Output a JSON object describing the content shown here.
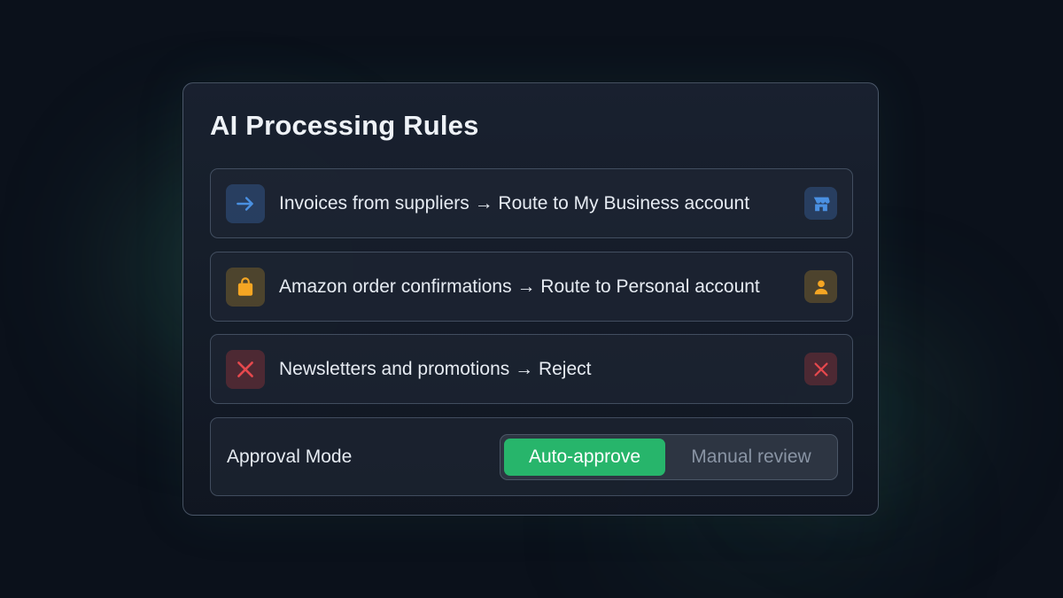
{
  "panel": {
    "title": "AI Processing Rules"
  },
  "rules": [
    {
      "text": "Invoices from suppliers → Route to My Business account",
      "lead_icon": "arrow-right-icon",
      "trail_icon": "store-icon",
      "accent": "#4a90e2"
    },
    {
      "text": "Amazon order confirmations → Route to Personal account",
      "lead_icon": "shopping-bag-icon",
      "trail_icon": "user-icon",
      "accent": "#f5a623"
    },
    {
      "text": "Newsletters and promotions → Reject",
      "lead_icon": "x-icon",
      "trail_icon": "x-icon",
      "accent": "#e5484d"
    }
  ],
  "approval": {
    "label": "Approval Mode",
    "options": [
      "Auto-approve",
      "Manual review"
    ],
    "selected": "Auto-approve",
    "active_color": "#27b56b"
  }
}
